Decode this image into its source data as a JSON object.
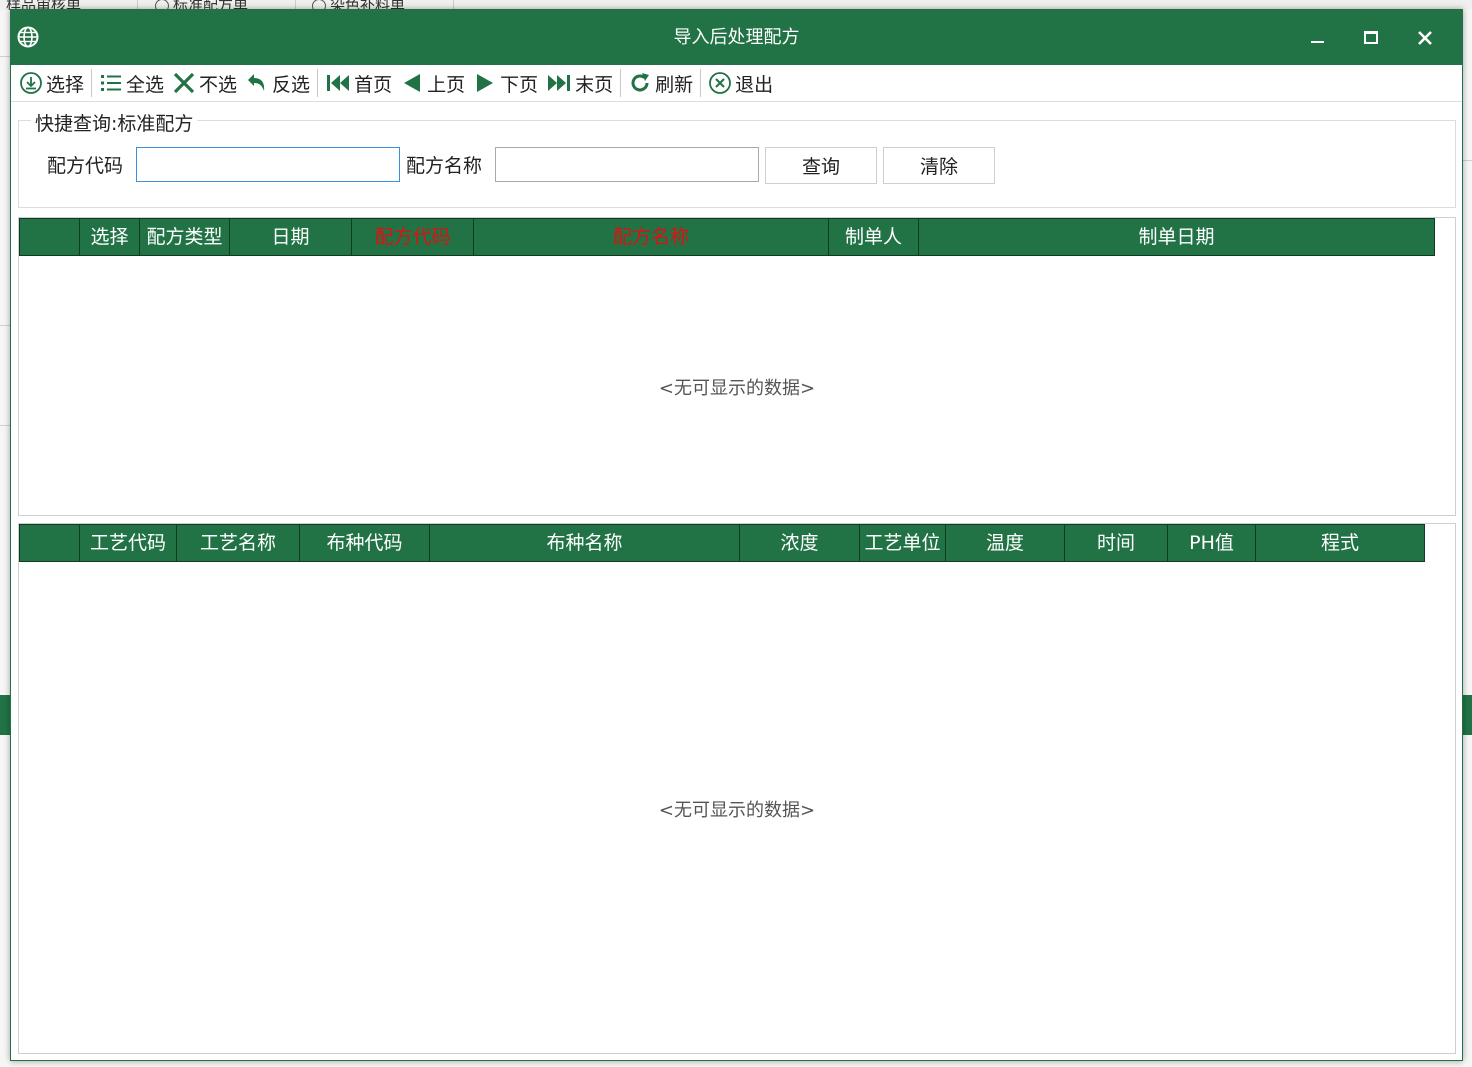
{
  "background": {
    "tabs": [
      {
        "label": "样品审核单"
      },
      {
        "label": "标准配方单"
      },
      {
        "label": "染色补料单"
      }
    ]
  },
  "dialog": {
    "title": "导入后处理配方",
    "controls": {
      "minimize": "minimize",
      "maximize": "maximize",
      "close": "close"
    }
  },
  "toolbar": {
    "select": "选择",
    "select_all": "全选",
    "deselect": "不选",
    "invert": "反选",
    "first_page": "首页",
    "prev_page": "上页",
    "next_page": "下页",
    "last_page": "末页",
    "refresh": "刷新",
    "exit": "退出"
  },
  "query": {
    "legend": "快捷查询:标准配方",
    "code_label": "配方代码",
    "code_value": "",
    "name_label": "配方名称",
    "name_value": "",
    "search_button": "查询",
    "clear_button": "清除"
  },
  "recipe_grid": {
    "columns": [
      "",
      "选择",
      "配方类型",
      "日期",
      "配方代码",
      "配方名称",
      "制单人",
      "制单日期"
    ],
    "empty_text": "<无可显示的数据>"
  },
  "process_grid": {
    "columns": [
      "",
      "工艺代码",
      "工艺名称",
      "布种代码",
      "布种名称",
      "浓度",
      "工艺单位",
      "温度",
      "时间",
      "PH值",
      "程式"
    ],
    "empty_text": "<无可显示的数据>"
  },
  "colors": {
    "brand_green": "#217346",
    "highlight_red": "#e01010",
    "focus_blue": "#3c8fd9"
  }
}
